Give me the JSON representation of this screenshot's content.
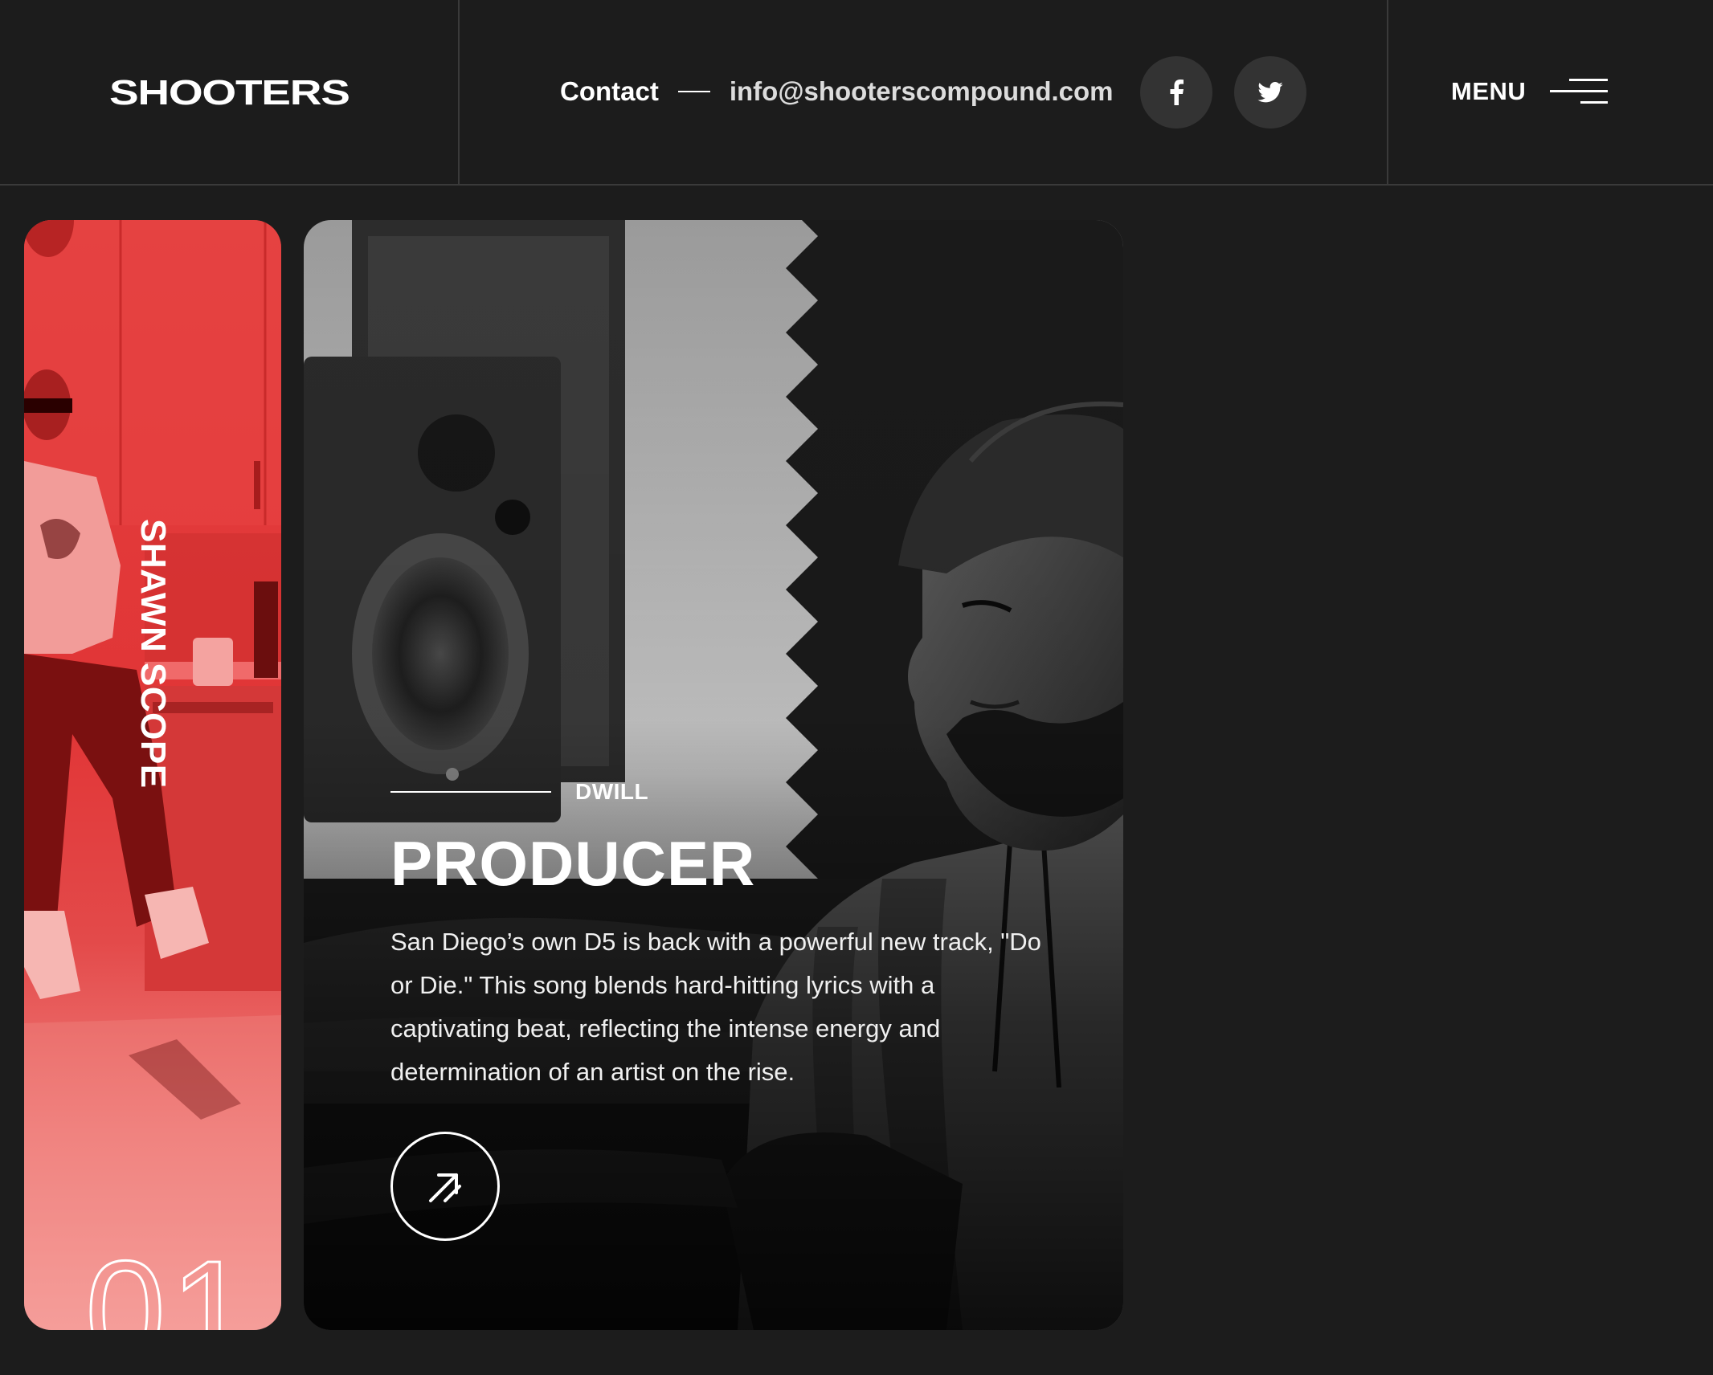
{
  "header": {
    "logo_text": "SHOOTERS",
    "contact_label": "Contact",
    "contact_email": "info@shooterscompound.com",
    "social": [
      {
        "icon": "facebook-icon"
      },
      {
        "icon": "twitter-icon"
      }
    ],
    "menu_label": "MENU"
  },
  "cards": {
    "side": {
      "name": "SHAWN SCOPE",
      "number": "01"
    },
    "main": {
      "name": "DWILL",
      "role": "PRODUCER",
      "description": "San Diego’s own D5 is back with a powerful new track, \"Do or Die.\" This song blends hard-hitting lyrics with a captivating beat, reflecting the intense energy and determination of an artist on the rise."
    }
  },
  "colors": {
    "background": "#1c1c1c",
    "accent_red": "#e13536",
    "button_dark": "#333333"
  }
}
